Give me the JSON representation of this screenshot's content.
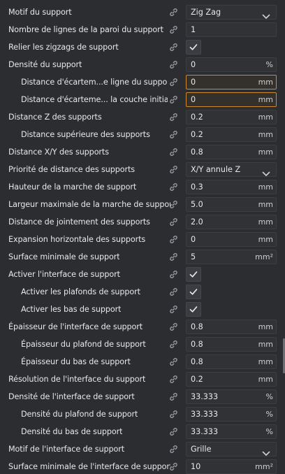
{
  "settings": [
    {
      "label": "Motif du support",
      "type": "dropdown",
      "value": "Zig Zag",
      "indent": 0
    },
    {
      "label": "Nombre de lignes de la paroi du support",
      "type": "text",
      "value": "1",
      "unit": "",
      "indent": 0
    },
    {
      "label": "Relier les zigzags de support",
      "type": "checkbox",
      "checked": true,
      "indent": 0
    },
    {
      "label": "Densité du support",
      "type": "text",
      "value": "0",
      "unit": "%",
      "indent": 0
    },
    {
      "label": "Distance d'écartem...e ligne du support",
      "type": "text",
      "value": "0",
      "unit": "mm",
      "indent": 1,
      "highlighted": true
    },
    {
      "label": "Distance d'écarteme... la couche initiale",
      "type": "text",
      "value": "0",
      "unit": "mm",
      "indent": 1,
      "highlighted": true
    },
    {
      "label": "Distance Z des supports",
      "type": "text",
      "value": "0.2",
      "unit": "mm",
      "indent": 0
    },
    {
      "label": "Distance supérieure des supports",
      "type": "text",
      "value": "0.2",
      "unit": "mm",
      "indent": 1
    },
    {
      "label": "Distance X/Y des supports",
      "type": "text",
      "value": "0.8",
      "unit": "mm",
      "indent": 0
    },
    {
      "label": "Priorité de distance des supports",
      "type": "dropdown",
      "value": "X/Y annule Z",
      "indent": 0
    },
    {
      "label": "Hauteur de la marche de support",
      "type": "text",
      "value": "0.3",
      "unit": "mm",
      "indent": 0
    },
    {
      "label": "Largeur maximale de la marche de support",
      "type": "text",
      "value": "5.0",
      "unit": "mm",
      "indent": 0
    },
    {
      "label": "Distance de jointement des supports",
      "type": "text",
      "value": "2.0",
      "unit": "mm",
      "indent": 0
    },
    {
      "label": "Expansion horizontale des supports",
      "type": "text",
      "value": "0",
      "unit": "mm",
      "indent": 0
    },
    {
      "label": "Surface minimale de support",
      "type": "text",
      "value": "5",
      "unit": "mm²",
      "indent": 0
    },
    {
      "label": "Activer l'interface de support",
      "type": "checkbox",
      "checked": true,
      "indent": 0
    },
    {
      "label": "Activer les plafonds de support",
      "type": "checkbox",
      "checked": true,
      "indent": 1
    },
    {
      "label": "Activer les bas de support",
      "type": "checkbox",
      "checked": true,
      "indent": 1
    },
    {
      "label": "Épaisseur de l'interface de support",
      "type": "text",
      "value": "0.8",
      "unit": "mm",
      "indent": 0
    },
    {
      "label": "Épaisseur du plafond de support",
      "type": "text",
      "value": "0.8",
      "unit": "mm",
      "indent": 1
    },
    {
      "label": "Épaisseur du bas de support",
      "type": "text",
      "value": "0.8",
      "unit": "mm",
      "indent": 1
    },
    {
      "label": "Résolution de l'interface du support",
      "type": "text",
      "value": "0.2",
      "unit": "mm",
      "indent": 0
    },
    {
      "label": "Densité de l'interface de support",
      "type": "text",
      "value": "33.333",
      "unit": "%",
      "indent": 0
    },
    {
      "label": "Densité du plafond de support",
      "type": "text",
      "value": "33.333",
      "unit": "%",
      "indent": 1
    },
    {
      "label": "Densité du bas de support",
      "type": "text",
      "value": "33.333",
      "unit": "%",
      "indent": 1
    },
    {
      "label": "Motif de l'interface de support",
      "type": "dropdown",
      "value": "Grille",
      "indent": 0
    },
    {
      "label": "Surface minimale de l'interface de support",
      "type": "text",
      "value": "10",
      "unit": "mm²",
      "indent": 0
    }
  ],
  "icons": {
    "link": "link-icon",
    "chevron": "chevron-down-icon",
    "check": "checkmark-icon"
  },
  "colors": {
    "background": "#2b2d31",
    "field_bg": "#303236",
    "field_border": "#3c3e43",
    "highlight_border": "#d08a2a",
    "text": "#e8e8e8",
    "icon": "#9a9ca1"
  }
}
